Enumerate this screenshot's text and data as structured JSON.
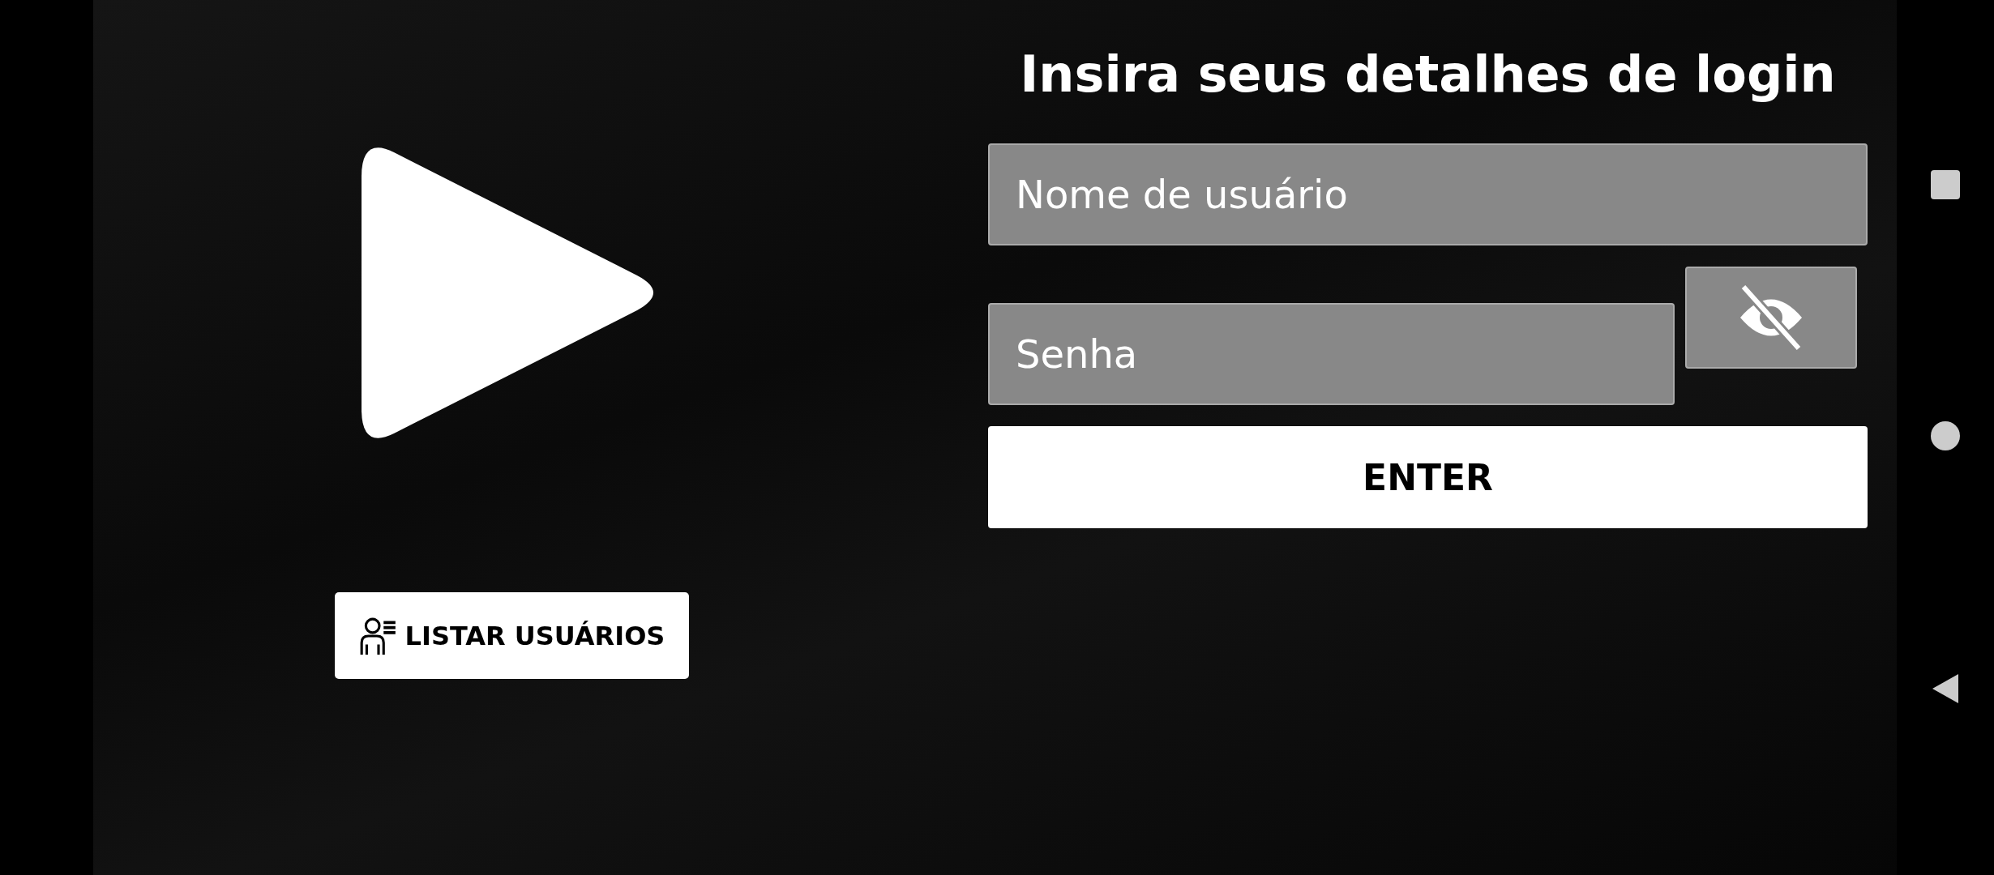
{
  "title": "Insira seus detalhes de login",
  "username": {
    "placeholder": "Nome de usuário"
  },
  "password": {
    "placeholder": "Senha",
    "visible": false
  },
  "enter_button": {
    "label": "ENTER"
  },
  "list_users_button": {
    "label": "LISTAR USUÁRIOS"
  }
}
